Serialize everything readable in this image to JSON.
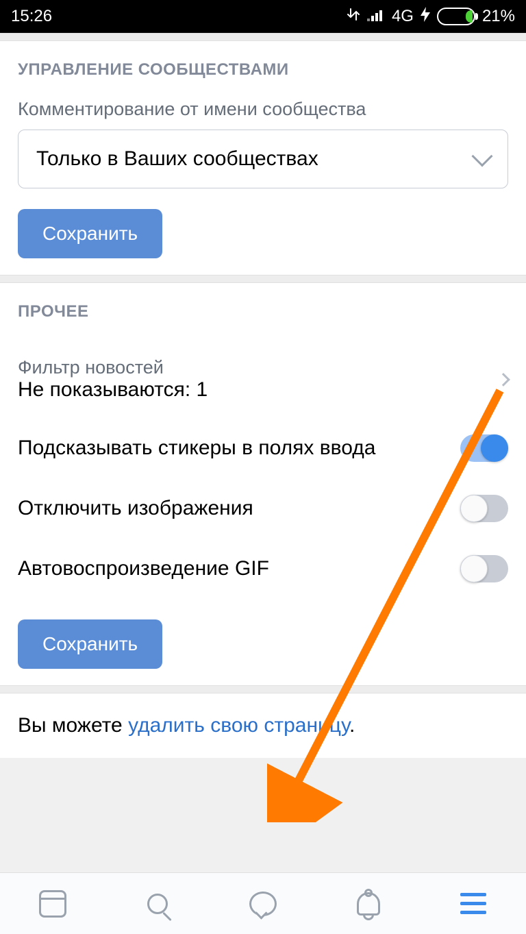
{
  "status": {
    "time": "15:26",
    "network": "4G",
    "battery_pct": "21%"
  },
  "section1": {
    "title": "УПРАВЛЕНИЕ СООБЩЕСТВАМИ",
    "comment_label": "Комментирование от имени сообщества",
    "select_value": "Только в Ваших сообществах",
    "save": "Сохранить"
  },
  "section2": {
    "title": "ПРОЧЕЕ",
    "filter_label": "Фильтр новостей",
    "filter_value": "Не показываются: 1",
    "stickers": "Подсказывать стикеры в полях ввода",
    "disable_images": "Отключить изображения",
    "autoplay_gif": "Автовоспроизведение GIF",
    "save": "Сохранить"
  },
  "footer": {
    "prefix": "Вы можете ",
    "link": "удалить свою страницу",
    "suffix": "."
  }
}
